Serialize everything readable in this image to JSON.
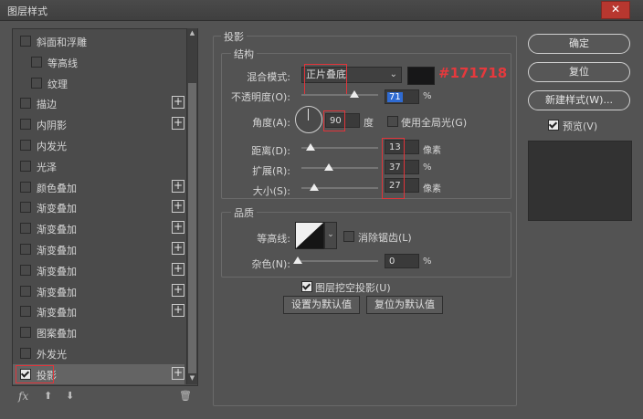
{
  "window": {
    "title": "图层样式",
    "close_label": "✕"
  },
  "left_list": {
    "items": [
      {
        "label": "斜面和浮雕",
        "sub": false,
        "plus": false,
        "active": false
      },
      {
        "label": "等高线",
        "sub": true,
        "plus": false,
        "active": false
      },
      {
        "label": "纹理",
        "sub": true,
        "plus": false,
        "active": false
      },
      {
        "label": "描边",
        "sub": false,
        "plus": true,
        "active": false
      },
      {
        "label": "内阴影",
        "sub": false,
        "plus": true,
        "active": false
      },
      {
        "label": "内发光",
        "sub": false,
        "plus": false,
        "active": false
      },
      {
        "label": "光泽",
        "sub": false,
        "plus": false,
        "active": false
      },
      {
        "label": "颜色叠加",
        "sub": false,
        "plus": true,
        "active": false
      },
      {
        "label": "渐变叠加",
        "sub": false,
        "plus": true,
        "active": false
      },
      {
        "label": "渐变叠加",
        "sub": false,
        "plus": true,
        "active": false
      },
      {
        "label": "渐变叠加",
        "sub": false,
        "plus": true,
        "active": false
      },
      {
        "label": "渐变叠加",
        "sub": false,
        "plus": true,
        "active": false
      },
      {
        "label": "渐变叠加",
        "sub": false,
        "plus": true,
        "active": false
      },
      {
        "label": "渐变叠加",
        "sub": false,
        "plus": true,
        "active": false
      },
      {
        "label": "图案叠加",
        "sub": false,
        "plus": false,
        "active": false
      },
      {
        "label": "外发光",
        "sub": false,
        "plus": false,
        "active": false
      },
      {
        "label": "投影",
        "sub": false,
        "plus": true,
        "active": true
      }
    ],
    "fx_label": "fx"
  },
  "drop_shadow": {
    "section_title": "投影",
    "structure_title": "结构",
    "blend_mode_label": "混合模式:",
    "blend_mode_value": "正片叠底",
    "color_annotation": "#171718",
    "shadow_color": "#171718",
    "opacity_label": "不透明度(O):",
    "opacity_value": "71",
    "opacity_unit": "%",
    "angle_label": "角度(A):",
    "angle_value": "90",
    "angle_unit": "度",
    "global_light_label": "使用全局光(G)",
    "distance_label": "距离(D):",
    "distance_value": "13",
    "distance_unit": "像素",
    "spread_label": "扩展(R):",
    "spread_value": "37",
    "spread_unit": "%",
    "size_label": "大小(S):",
    "size_value": "27",
    "size_unit": "像素",
    "quality_title": "品质",
    "contour_label": "等高线:",
    "antialias_label": "消除锯齿(L)",
    "noise_label": "杂色(N):",
    "noise_value": "0",
    "noise_unit": "%",
    "knockout_label": "图层挖空投影(U)",
    "make_default_label": "设置为默认值",
    "reset_default_label": "复位为默认值"
  },
  "right_panel": {
    "ok_label": "确定",
    "reset_label": "复位",
    "new_style_label": "新建样式(W)...",
    "preview_label": "预览(V)"
  }
}
